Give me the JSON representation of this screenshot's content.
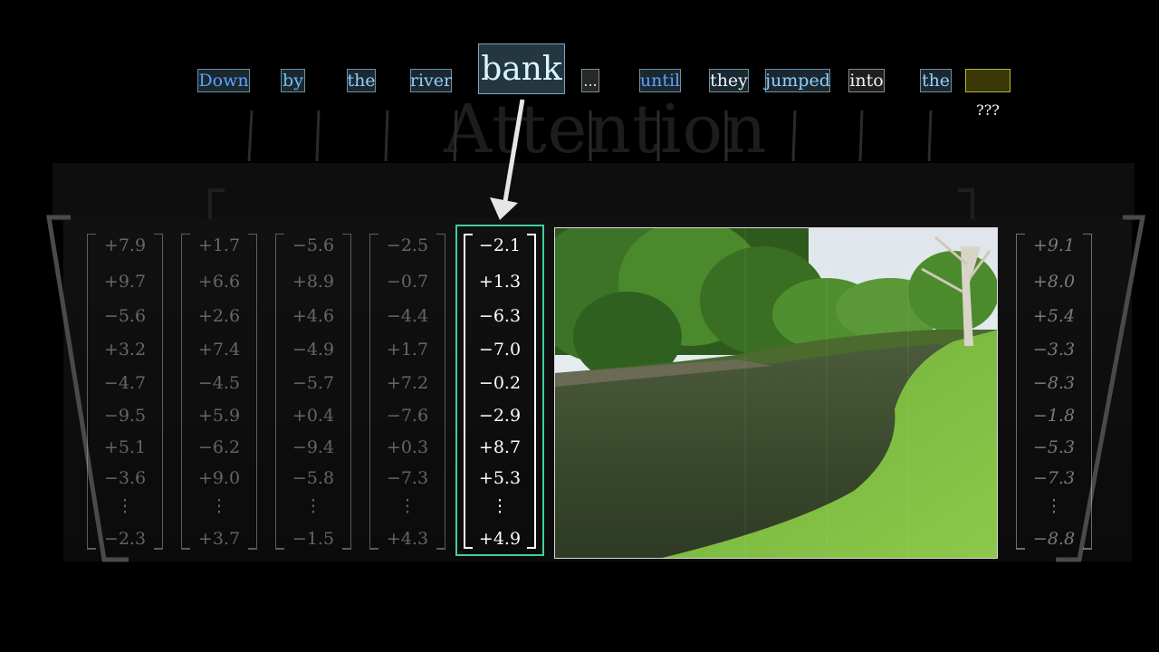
{
  "sentence": {
    "tokens": [
      {
        "text": "Down",
        "color": "#5aa2ff"
      },
      {
        "text": "by",
        "color": "#6fc0ff"
      },
      {
        "text": "the",
        "color": "#8fd0ff"
      },
      {
        "text": "river",
        "color": "#8fd0ff"
      },
      {
        "text": "bank",
        "color": "#d7f6ff"
      },
      {
        "text": "...",
        "color": "#e4e4e4"
      },
      {
        "text": "until",
        "color": "#5aa2ff"
      },
      {
        "text": "they",
        "color": "#e8f4ff"
      },
      {
        "text": "jumped",
        "color": "#8fd0ff"
      },
      {
        "text": "into",
        "color": "#f2f2f2"
      },
      {
        "text": "the",
        "color": "#8fd0ff"
      },
      {
        "text": "",
        "color": "#3a3807"
      }
    ],
    "unknown_label": "???"
  },
  "background_title": "Attention",
  "embeddings": {
    "columns": [
      {
        "values": [
          "+7.9",
          "+9.7",
          "−5.6",
          "+3.2",
          "−4.7",
          "−9.5",
          "+5.1",
          "−3.6",
          "⋮",
          "−2.3"
        ]
      },
      {
        "values": [
          "+1.7",
          "+6.6",
          "+2.6",
          "+7.4",
          "−4.5",
          "+5.9",
          "−6.2",
          "+9.0",
          "⋮",
          "+3.7"
        ]
      },
      {
        "values": [
          "−5.6",
          "+8.9",
          "+4.6",
          "−4.9",
          "−5.7",
          "+0.4",
          "−9.4",
          "−5.8",
          "⋮",
          "−1.5"
        ]
      },
      {
        "values": [
          "−2.5",
          "−0.7",
          "−4.4",
          "+1.7",
          "+7.2",
          "−7.6",
          "+0.3",
          "−7.3",
          "⋮",
          "+4.3"
        ]
      }
    ],
    "focus_column": {
      "values": [
        "−2.1",
        "+1.3",
        "−6.3",
        "−7.0",
        "−0.2",
        "−2.9",
        "+8.7",
        "+5.3",
        "⋮",
        "+4.9"
      ]
    },
    "right_column": {
      "values": [
        "+9.1",
        "+8.0",
        "+5.4",
        "−3.3",
        "−8.3",
        "−1.8",
        "−5.3",
        "−7.3",
        "⋮",
        "−8.8"
      ]
    }
  },
  "colors": {
    "focus_border": "#3fcf9e",
    "arrow": "#e6e6e6",
    "background": "#000000"
  }
}
